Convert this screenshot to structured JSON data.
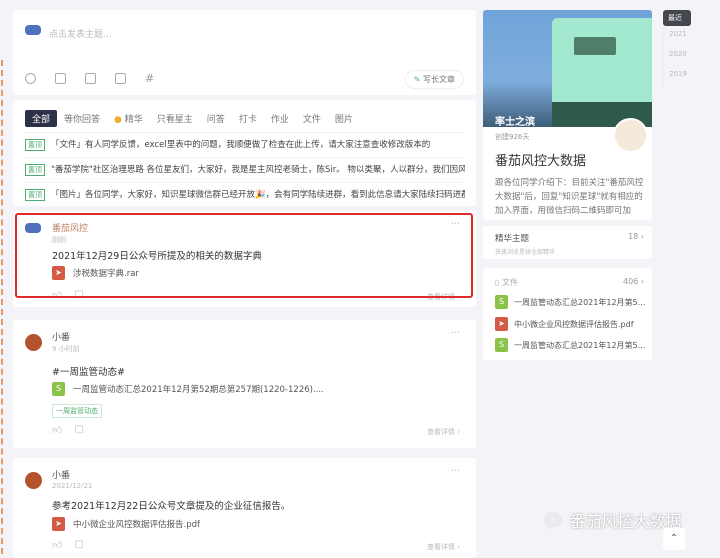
{
  "composer": {
    "placeholder": "点击发表主题...",
    "long_article": "写长文章",
    "tools": [
      "emoji-icon",
      "image-icon",
      "file-icon",
      "video-icon",
      "hashtag-icon"
    ]
  },
  "filter": {
    "tabs": [
      "全部",
      "等你回答",
      "精华",
      "只看星主",
      "问答",
      "打卡",
      "作业",
      "文件",
      "图片"
    ],
    "pin_label": "置顶",
    "pinned": [
      "「文件」有人同学反馈，excel里表中的问题，我顺便做了检查在此上传，请大家注意查收修改版本的",
      "\"番茄学院\"社区治理思路 各位星友们，大家好，我是星主风控老骑士，陈Sir。 物以类聚，人以群分，我们因风控...",
      "「图片」各位同学，大家好，知识星球微信群已经开放🎉，会有同学陆续进群，看到此信息请大家陆续扫码进群..."
    ]
  },
  "posts": [
    {
      "author": "番茄风控",
      "time": "刚刚",
      "text": "2021年12月29日公众号所提及的相关的数据字典",
      "file": "涉税数据字典.rar",
      "file_type": "pdf",
      "detail": "查看详情 ›"
    },
    {
      "author": "小番",
      "time": "9 小时前",
      "text": "#一周监管动态#",
      "file": "一周监管动态汇总2021年12月第52期总第257期(1220-1226)....",
      "file_type": "xls",
      "tag": "一周监管动态",
      "detail": "查看详情 ›"
    },
    {
      "author": "小番",
      "time": "2021/12/21",
      "text": "参考2021年12月22日公众号文章提及的企业征信报告。",
      "file": "中小微企业风控数据评估报告.pdf",
      "file_type": "pdf",
      "detail": "查看详情 ›"
    }
  ],
  "profile": {
    "cover_name": "率士之滨",
    "created": "创建926天",
    "title": "番茄风控大数据",
    "desc": "跟各位同学介绍下：目前关注\"番茄风控大数据\"后，回复\"知识星球\"就有相应的加入界面，用微信扫码二维码即可加入... 展开"
  },
  "essence": {
    "label": "精华主题",
    "sub": "快速浏览星球全部精华",
    "count": "18 ›"
  },
  "files": {
    "label": "文件",
    "count": "406 ›",
    "items": [
      {
        "name": "一周监管动态汇总2021年12月第5...",
        "type": "xls"
      },
      {
        "name": "中小微企业风控数据评估报告.pdf",
        "type": "pdf"
      },
      {
        "name": "一周监管动态汇总2021年12月第5...",
        "type": "xls"
      }
    ]
  },
  "timeline": [
    "最近",
    "2021",
    "2020",
    "2019"
  ],
  "watermark": "番茄风控大数据"
}
